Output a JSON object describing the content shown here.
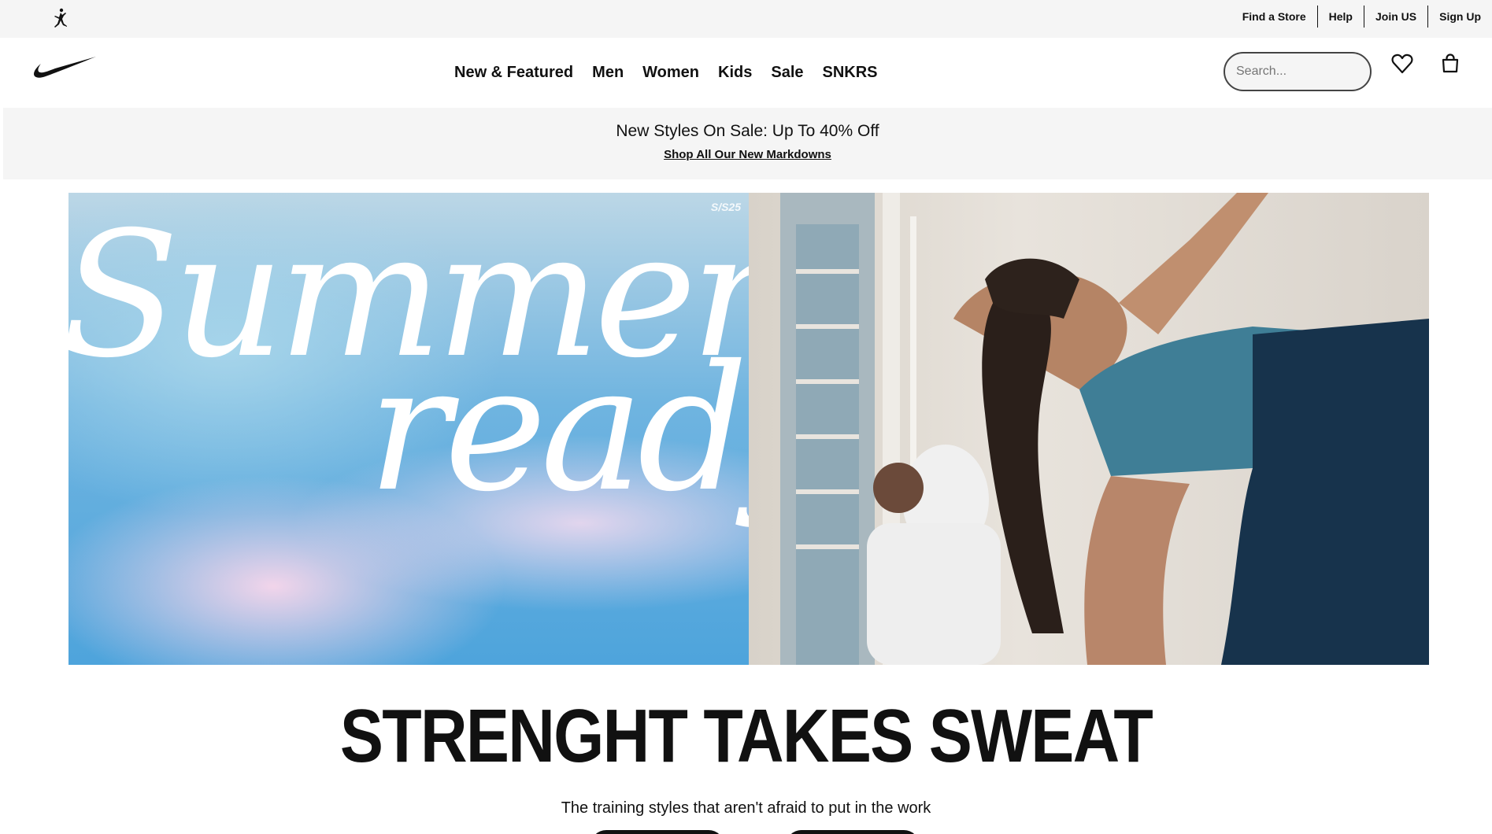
{
  "utility": {
    "links": [
      "Find a Store",
      "Help",
      "Join US",
      "Sign Up"
    ]
  },
  "nav": {
    "items": [
      "New & Featured",
      "Men",
      "Women",
      "Kids",
      "Sale",
      "SNKRS"
    ]
  },
  "search": {
    "placeholder": "Search..."
  },
  "promo": {
    "title": "New Styles On Sale: Up To 40% Off",
    "link": "Shop All Our New Markdowns"
  },
  "hero": {
    "badge": "S/S25",
    "word1": "Summer",
    "word2": "ready"
  },
  "main": {
    "headline": "STRENGHT TAKES SWEAT",
    "subline": "The training styles that aren't afraid to put in the work"
  },
  "colors": {
    "accent": "#111111",
    "utility_bg": "#f5f5f5",
    "sky_blue": "#4ea4dc"
  },
  "icons": [
    "jordan-jumpman-icon",
    "nike-swoosh-logo",
    "heart-icon",
    "bag-icon"
  ]
}
